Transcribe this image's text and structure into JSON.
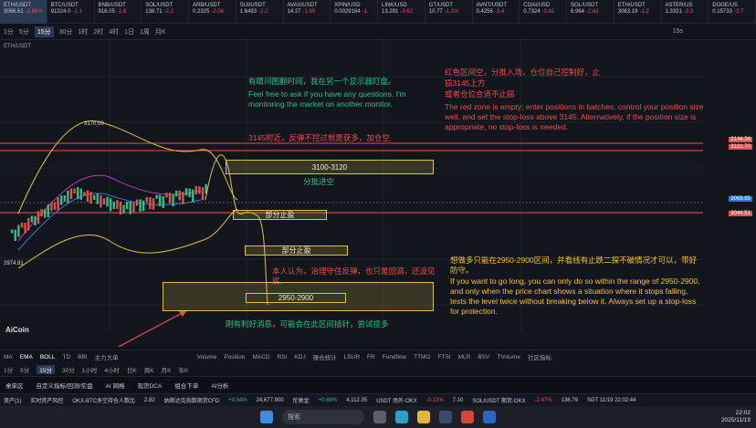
{
  "tickers": [
    {
      "name": "ETH/USDT",
      "price": "3066.61",
      "change": "-1.86%",
      "dir": "dn",
      "selected": true
    },
    {
      "name": "BTC/USDT",
      "price": "91324.0",
      "change": "-1.1",
      "dir": "dn"
    },
    {
      "name": "BNB/USDT",
      "price": "916.05",
      "change": "-1.6",
      "dir": "dn"
    },
    {
      "name": "SOL/USDT",
      "price": "138.71",
      "change": "-2.2",
      "dir": "dn"
    },
    {
      "name": "ARB/USDT",
      "price": "0.2325",
      "change": "-2.06",
      "dir": "dn"
    },
    {
      "name": "SUI/USDT",
      "price": "1.6493",
      "change": "-2.2",
      "dir": "dn"
    },
    {
      "name": "AVAX/USDT",
      "price": "14.27",
      "change": "-1.99",
      "dir": "dn"
    },
    {
      "name": "XPIN/USD",
      "price": "0.0029164",
      "change": "-1.",
      "dir": "dn"
    },
    {
      "name": "LINK/USD",
      "price": "13.291",
      "change": "-3.62",
      "dir": "dn"
    },
    {
      "name": "GT/USDT",
      "price": "10.77",
      "change": "-1.1%",
      "dir": "dn"
    },
    {
      "name": "AVNT/USDT",
      "price": "0.4256",
      "change": "-3.4",
      "dir": "dn"
    },
    {
      "name": "COAI/USD",
      "price": "0.7324",
      "change": "-3.81",
      "dir": "dn"
    },
    {
      "name": "SOL/USDT",
      "price": "6.964",
      "change": "-2.42",
      "dir": "dn"
    },
    {
      "name": "ETH/USDT",
      "price": "3063.19",
      "change": "-1.2",
      "dir": "dn"
    },
    {
      "name": "ASTER/US",
      "price": "1.3331",
      "change": "-3.3",
      "dir": "dn"
    },
    {
      "name": "DOGE/US",
      "price": "0.15733",
      "change": "-2.7",
      "dir": "dn"
    }
  ],
  "toolbar": {
    "items": [
      "1分",
      "5分",
      "15分",
      "30分",
      "1时",
      "2时",
      "4时",
      "1日",
      "1周",
      "月K"
    ],
    "active": "15分",
    "right": "15s"
  },
  "chart": {
    "symbol": "ETH/USDT",
    "high_label": "3170.00",
    "low_label": "2974.81",
    "price_labels": [
      {
        "v": "3144.36",
        "c": "#e4504f"
      },
      {
        "v": "3131.70",
        "c": "#e4504f"
      },
      {
        "v": "3069.95",
        "c": "#2e7bd6"
      },
      {
        "v": "3044.51",
        "c": "#e4504f"
      }
    ],
    "notes": {
      "cn_top_left": "有睛问图翻时间，我在另一个显示器盯盘。",
      "en_top_left": "Feel free to ask if you have any questions. I'm monitoring the market on another monitor.",
      "cn_top_right_1": "红色区间空，分批入场，仓位自己控制好，止",
      "cn_top_right_2": "损3145上方",
      "cn_top_right_3": "或者仓位合适不止损",
      "en_top_right": "The red zone is empty; enter positions in batches, control your position size well, and set the stop-loss above 3145. Alternatively, if the position size is appropriate, no stop-loss is needed.",
      "cn_3145": "3145附近，反弹不控过就是获多，加仓空",
      "zone_3100": "3100-3120",
      "zone_3100_label": "分批进空",
      "partial_tp_1": "部分止盈",
      "partial_tp_2": "部分止盈",
      "cn_mid": "本人认为，治理守住反弹，也只是回调，还没见底。",
      "zone_2950": "2950-2900",
      "cn_bottom": "刚有利好消息，可能会在此区间插针，尝试接多",
      "cn_right_yellow": "想做多只能在2950-2900区间，并看线有止跌二探不破情况才可以，带好防守。",
      "en_right_yellow": "If you want to go long, you can only do so within the range of 2950-2900, and only when the price chart shows a situation where it stops falling, tests the level twice without breaking below it. Always set up a stop-loss for protection.",
      "watermark": "AiCoin"
    }
  },
  "indicators": {
    "left": [
      "MA",
      "EMA",
      "BOLL",
      "TD",
      "BBI",
      "主力大单"
    ],
    "active": [
      "EMA",
      "BOLL"
    ],
    "right": [
      "Volume",
      "Position",
      "MACD",
      "RSI",
      "KDJ",
      "操仓统计",
      "LSUR",
      "FR",
      "Fundflow",
      "TTMO",
      "FTSI",
      "MLR",
      "BSV",
      "TVolume",
      "社区指标"
    ]
  },
  "timeframes": {
    "items": [
      "1分",
      "5分",
      "15分",
      "30分",
      "1小时",
      "4小时",
      "日K",
      "周K",
      "月K",
      "年K"
    ],
    "active": "15分"
  },
  "botnav": [
    "桌单区",
    "自定义指标/回测/实盘",
    "AI 网格",
    "现货DCA",
    "组合下单",
    "AI分析"
  ],
  "statusbar": [
    {
      "t": "资产(1)",
      "c": "#c8ccd4"
    },
    {
      "t": "实时资产风控",
      "c": "#c8ccd4"
    },
    {
      "t": "OKX-BTC多空持仓人数比",
      "c": "#c8ccd4"
    },
    {
      "t": "2.82",
      "c": "#c8ccd4"
    },
    {
      "t": "纳斯达克指数期货CFD",
      "c": "#c8ccd4"
    },
    {
      "t": "+0.34%",
      "c": "#2ebd85"
    },
    {
      "t": "24,677.900",
      "c": "#c8ccd4"
    },
    {
      "t": "伦敦金",
      "c": "#c8ccd4"
    },
    {
      "t": "+0.88%",
      "c": "#2ebd85"
    },
    {
      "t": "4,112.35",
      "c": "#c8ccd4"
    },
    {
      "t": "USDT 场外-OKX",
      "c": "#c8ccd4"
    },
    {
      "t": "-0.13%",
      "c": "#e4504f"
    },
    {
      "t": "7.10",
      "c": "#c8ccd4"
    },
    {
      "t": "SOL/USDT 期货-OKX",
      "c": "#c8ccd4"
    },
    {
      "t": "-2.47%",
      "c": "#e4504f"
    },
    {
      "t": "136.79",
      "c": "#c8ccd4"
    },
    {
      "t": "SGT 11/19 22:02:44",
      "c": "#c8ccd4"
    }
  ],
  "taskbar": {
    "search": "搜索",
    "time": "22:02",
    "date": "2025/11/19"
  }
}
